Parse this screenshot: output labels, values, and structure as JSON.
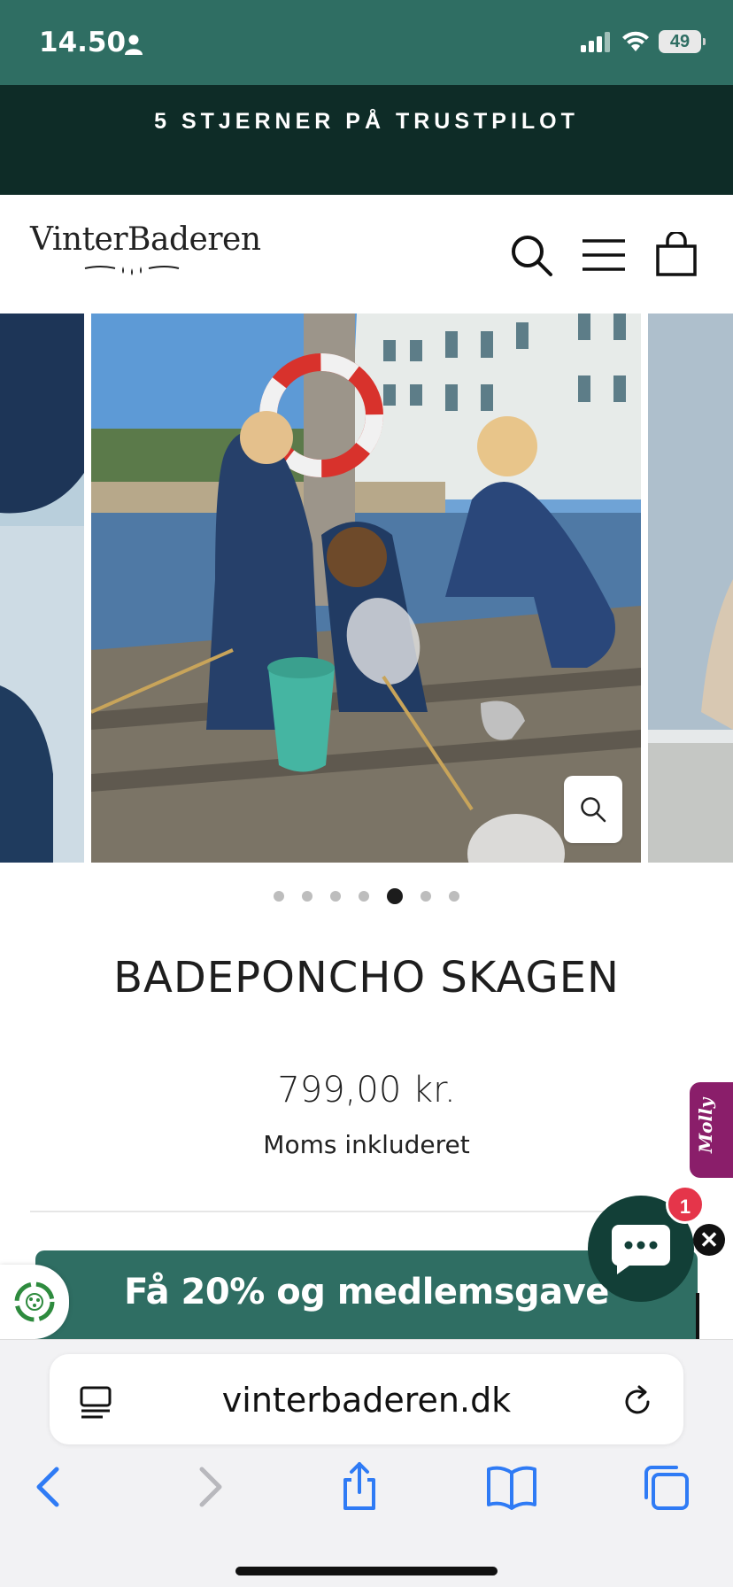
{
  "status_bar": {
    "time": "14.50",
    "battery": "49"
  },
  "announcement": {
    "text": "5 STJERNER PÅ TRUSTPILOT"
  },
  "header": {
    "logo_text": "VinterBaderen"
  },
  "gallery": {
    "dot_count": 7,
    "active_index": 4
  },
  "product": {
    "title": "BADEPONCHO SKAGEN",
    "price": "799,00 kr.",
    "tax_note": "Moms inkluderet"
  },
  "molly_tab": {
    "label": "Molly"
  },
  "chat": {
    "badge_count": "1",
    "close_label": "✕"
  },
  "promo": {
    "text": "Få 20% og medlemsgave"
  },
  "browser": {
    "url": "vinterbaderen.dk"
  },
  "colors": {
    "brand_green": "#2f6e63",
    "dark_green": "#0e2c27",
    "chat_green": "#123f37",
    "molly_purple": "#8a1e6a",
    "badge_red": "#e5354a",
    "ios_blue": "#2f7bf5"
  }
}
